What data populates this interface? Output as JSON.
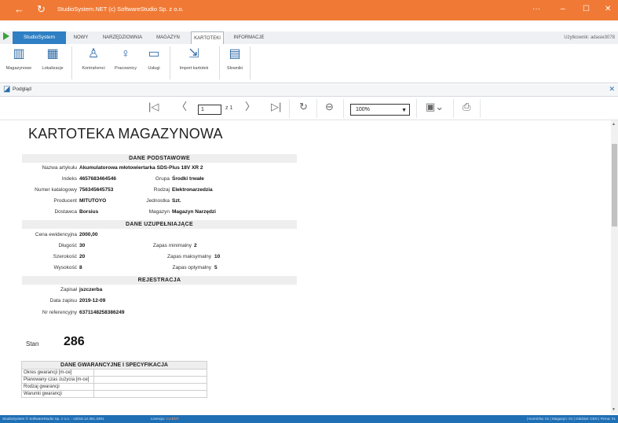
{
  "window": {
    "title": "StudioSystem.NET (c) SoftwareStudio Sp. z o.o.",
    "minimize": "–",
    "maximize": "☐",
    "close": "✕",
    "more": "···"
  },
  "menu": {
    "app_tab": "StudioSystem",
    "tabs": [
      "NOWY",
      "NARZĘDZIOWNIA",
      "MAGAZYN",
      "KARTOTEKI",
      "INFORMACJE"
    ],
    "active_tab": "KARTOTEKI",
    "user": "Użytkownik: adasie3078"
  },
  "ribbon": {
    "buttons": [
      "Magazynowe",
      "Lokalizacje",
      "Kontrahenci",
      "Pracownicy",
      "Usługi",
      "Import kartotek",
      "Słowniki"
    ]
  },
  "panel": {
    "title": "Podgląd"
  },
  "toolbar": {
    "page_value": "1",
    "page_of": "z 1",
    "zoom_value": "100%"
  },
  "document": {
    "title": "KARTOTEKA MAGAZYNOWA",
    "sections": {
      "basic": "DANE PODSTAWOWE",
      "extra": "DANE UZUPEŁNIAJĄCE",
      "registration": "REJESTRACJA",
      "warranty": "DANE GWARANCYJNE I SPECYFIKACJA"
    },
    "fields": {
      "nazwa_label": "Nazwa artykułu",
      "nazwa": "Akumulatorowa młotowiertarka SDS-Plus 18V XR 2",
      "indeks_label": "Indeks",
      "indeks": "4657683464546",
      "grupa_label": "Grupa",
      "grupa": "Środki trwałe",
      "katalog_label": "Numer katalogowy",
      "katalog": "756345645753",
      "rodzaj_label": "Rodzaj",
      "rodzaj": "Elektronarzedzia",
      "producent_label": "Producent",
      "producent": "MITUTOYO",
      "jednostka_label": "Jednostka",
      "jednostka": "Szt.",
      "dostawca_label": "Dostawca",
      "dostawca": "Borsius",
      "magazyn_label": "Magazyn",
      "magazyn": "Magazyn Narzędzi",
      "cena_label": "Cena ewidencyjna",
      "cena": "2000,00",
      "dlugosc_label": "Długość",
      "dlugosc": "30",
      "zapas_min_label": "Zapas minimalny",
      "zapas_min": "2",
      "szerokosc_label": "Szerokość",
      "szerokosc": "20",
      "zapas_max_label": "Zapas maksymalny",
      "zapas_max": "10",
      "wysokosc_label": "Wysokość",
      "wysokosc": "8",
      "zapas_opt_label": "Zapas optymalny",
      "zapas_opt": "5",
      "zapisal_label": "Zapisał",
      "zapisal": "jszczerba",
      "data_label": "Data zapisu",
      "data": "2019-12-09",
      "nrref_label": "Nr referencyjny",
      "nrref": "6371148258386249"
    },
    "stan_label": "Stan",
    "stan_value": "286",
    "warranty_rows": [
      {
        "k": "Okres gwarancji [m-ce]",
        "v": ""
      },
      {
        "k": "Planowany czas zużycia [m-ce]",
        "v": ""
      },
      {
        "k": "Rodzaj gwarancji",
        "v": ""
      },
      {
        "k": "Warunki gwarancji",
        "v": ""
      }
    ]
  },
  "status": {
    "left": "StudioSystem © SoftwareStudio Sp. z o.o. - v2019.12.351.2291",
    "license_label": "Licencja:",
    "license_value": "CLIENT",
    "right": "| Komórka: 01 | Magazyn: 01 | Oddział: CEN | Firma: 01"
  }
}
